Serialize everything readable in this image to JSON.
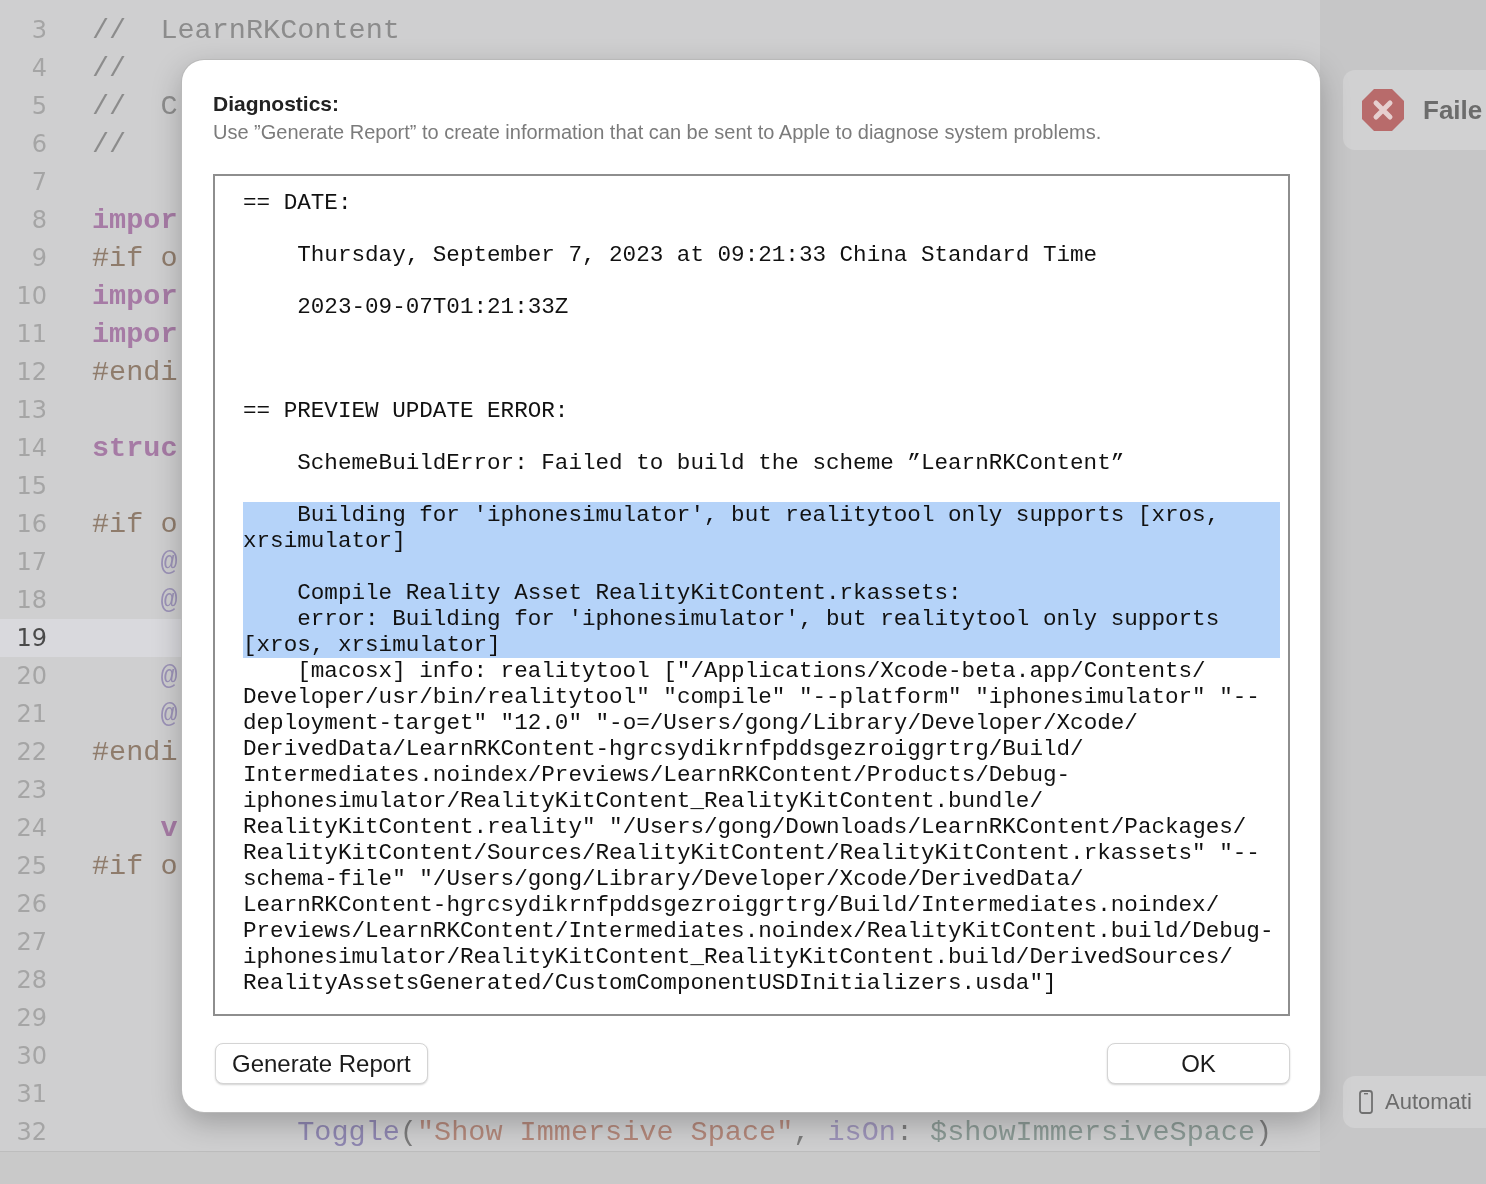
{
  "editor": {
    "lines": [
      {
        "number": "3",
        "selected": false,
        "tokens": [
          {
            "text": "//  LearnRKContent",
            "kind": "comment"
          }
        ]
      },
      {
        "number": "4",
        "selected": false,
        "tokens": [
          {
            "text": "//",
            "kind": "comment"
          }
        ]
      },
      {
        "number": "5",
        "selected": false,
        "tokens": [
          {
            "text": "//  C",
            "kind": "comment"
          }
        ]
      },
      {
        "number": "6",
        "selected": false,
        "tokens": [
          {
            "text": "//",
            "kind": "comment"
          }
        ]
      },
      {
        "number": "7",
        "selected": false
      },
      {
        "number": "8",
        "selected": false,
        "tokens": [
          {
            "text": "impor",
            "kind": "keyword"
          }
        ]
      },
      {
        "number": "9",
        "selected": false,
        "tokens": [
          {
            "text": "#if o",
            "kind": "directive"
          }
        ]
      },
      {
        "number": "10",
        "selected": false,
        "tokens": [
          {
            "text": "impor",
            "kind": "keyword"
          }
        ]
      },
      {
        "number": "11",
        "selected": false,
        "tokens": [
          {
            "text": "impor",
            "kind": "keyword"
          }
        ]
      },
      {
        "number": "12",
        "selected": false,
        "tokens": [
          {
            "text": "#endi",
            "kind": "directive"
          }
        ]
      },
      {
        "number": "13",
        "selected": false
      },
      {
        "number": "14",
        "selected": false,
        "tokens": [
          {
            "text": "struc",
            "kind": "keyword"
          }
        ]
      },
      {
        "number": "15",
        "selected": false
      },
      {
        "number": "16",
        "selected": false,
        "tokens": [
          {
            "text": "#if o",
            "kind": "directive"
          }
        ]
      },
      {
        "number": "17",
        "selected": false,
        "tokens": [
          {
            "text": "    @",
            "kind": "attribute"
          }
        ]
      },
      {
        "number": "18",
        "selected": false,
        "tokens": [
          {
            "text": "    @",
            "kind": "attribute"
          }
        ]
      },
      {
        "number": "19",
        "selected": true
      },
      {
        "number": "20",
        "selected": false,
        "tokens": [
          {
            "text": "    @",
            "kind": "attribute"
          }
        ]
      },
      {
        "number": "21",
        "selected": false,
        "tokens": [
          {
            "text": "    @",
            "kind": "attribute"
          }
        ]
      },
      {
        "number": "22",
        "selected": false,
        "tokens": [
          {
            "text": "#endi",
            "kind": "directive"
          }
        ]
      },
      {
        "number": "23",
        "selected": false
      },
      {
        "number": "24",
        "selected": false,
        "tokens": [
          {
            "text": "    v",
            "kind": "keyword"
          }
        ]
      },
      {
        "number": "25",
        "selected": false,
        "tokens": [
          {
            "text": "#if o",
            "kind": "directive"
          }
        ]
      },
      {
        "number": "26",
        "selected": false
      },
      {
        "number": "27",
        "selected": false
      },
      {
        "number": "28",
        "selected": false
      },
      {
        "number": "29",
        "selected": false
      },
      {
        "number": "30",
        "selected": false
      },
      {
        "number": "31",
        "selected": false
      },
      {
        "number": "32",
        "selected": false,
        "tokens": [
          {
            "text": "            Toggle",
            "kind": "type"
          },
          {
            "text": "(",
            "kind": "plain"
          },
          {
            "text": "\"Show Immersive Space\"",
            "kind": "string"
          },
          {
            "text": ", ",
            "kind": "plain"
          },
          {
            "text": "isOn",
            "kind": "attribute"
          },
          {
            "text": ": ",
            "kind": "plain"
          },
          {
            "text": "$showImmersiveSpace",
            "kind": "variable"
          },
          {
            "text": ")",
            "kind": "plain"
          }
        ]
      }
    ]
  },
  "notifications": [
    {
      "kind": "error",
      "text": "Faile"
    },
    {
      "kind": "device",
      "text": "Automati"
    }
  ],
  "dialog": {
    "title": "Diagnostics:",
    "message": "Use ”Generate Report” to create information that can be sent to Apple to diagnose system problems.",
    "report": [
      {
        "heading": "== DATE:",
        "entries": [
          [
            {
              "text": "Thursday, September 7, 2023 at 09:21:33 China Standard Time",
              "selected": false
            }
          ],
          [
            {
              "text": "2023-09-07T01:21:33Z",
              "selected": false
            }
          ]
        ]
      },
      {
        "heading": "== PREVIEW UPDATE ERROR:",
        "entries": [
          [
            {
              "text": "SchemeBuildError: Failed to build the scheme ”LearnRKContent”",
              "selected": false
            }
          ],
          [
            {
              "text": "Building for 'iphonesimulator', but realitytool only supports [xros, xrsimulator]",
              "selected": true
            }
          ],
          [
            {
              "text": "Compile Reality Asset RealityKitContent.rkassets:",
              "selected": true
            },
            {
              "text": "error: Building for 'iphonesimulator', but realitytool only supports [xros, xrsimulator]",
              "selected": true
            },
            {
              "text": "[macosx] info: realitytool [\"/Applications/Xcode-beta.app/Contents/Developer/usr/bin/realitytool\" \"compile\" \"--platform\" \"iphonesimulator\" \"--deployment-target\" \"12.0\" \"-o=/Users/gong/Library/Developer/Xcode/DerivedData/LearnRKContent-hgrcsydikrnfpddsgezroiggrtrg/Build/Intermediates.noindex/Previews/LearnRKContent/Products/Debug-iphonesimulator/RealityKitContent_RealityKitContent.bundle/RealityKitContent.reality\" \"/Users/gong/Downloads/LearnRKContent/Packages/RealityKitContent/Sources/RealityKitContent/RealityKitContent.rkassets\" \"--schema-file\" \"/Users/gong/Library/Developer/Xcode/DerivedData/LearnRKContent-hgrcsydikrnfpddsgezroiggrtrg/Build/Intermediates.noindex/Previews/LearnRKContent/Intermediates.noindex/RealityKitContent.build/Debug-iphonesimulator/RealityKitContent_RealityKitContent.build/DerivedSources/RealityAssetsGenerated/CustomComponentUSDInitializers.usda\"]",
              "selected": false
            }
          ]
        ]
      }
    ]
  },
  "buttons": [
    "Generate Report",
    "OK"
  ]
}
